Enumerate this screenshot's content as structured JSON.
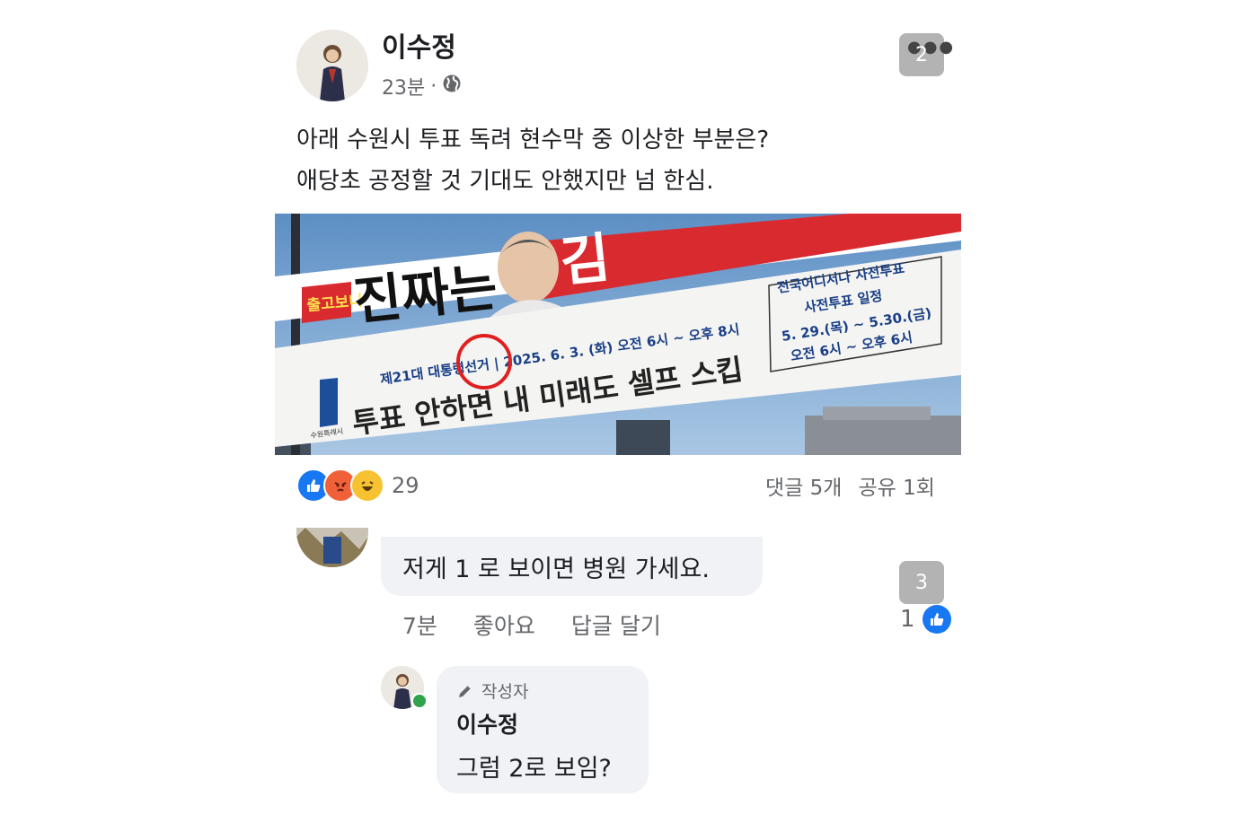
{
  "post": {
    "author_name": "이수정",
    "time": "23분",
    "separator": "·",
    "line1": "아래 수원시 투표 독려 현수막 중 이상한 부분은?",
    "line2": "애당초 공정할 것 기대도 안했지만 넘 한심.",
    "more_badge": "2"
  },
  "banner": {
    "slogan": "진짜는",
    "tagline": "투표 안하면 내 미래도 셀프 스킵",
    "election_line": "제21대 대통령선거 | 2025. 6. 3. (화) 오전 6시 ~ 오후 8시",
    "early_title": "전국어디서나 사전투표",
    "early_subtitle": "사전투표 일정",
    "early_dates": "5. 29.(목) ~ 5.30.(금)",
    "early_hours": "오전 6시 ~ 오후 6시",
    "city": "수원특례시"
  },
  "stats": {
    "reaction_count": "29",
    "comments": "댓글 5개",
    "shares": "공유 1회"
  },
  "comment1": {
    "text": "저게 1 로 보이면 병원 가세요.",
    "time": "7분",
    "like_label": "좋아요",
    "reply_label": "답글 달기",
    "like_count": "1",
    "thread_badge": "3"
  },
  "reply": {
    "author_tag": "작성자",
    "name": "이수정",
    "text": "그럼 2로 보임?"
  },
  "colors": {
    "like_blue": "#1877f2",
    "bubble_gray": "#f0f2f5",
    "meta_gray": "#65676b",
    "highlight_circle": "#e02020"
  }
}
